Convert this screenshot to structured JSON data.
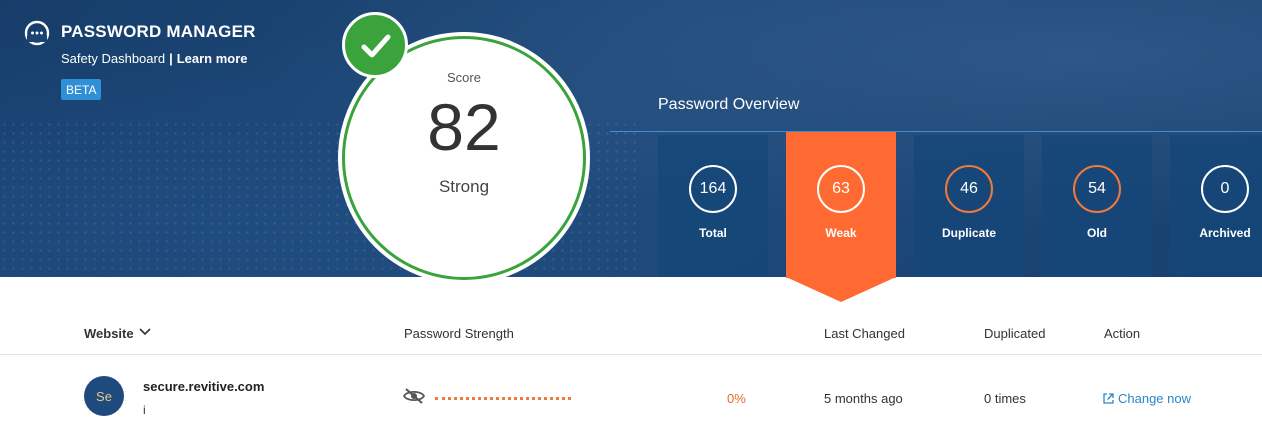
{
  "header": {
    "title": "PASSWORD MANAGER",
    "subtitle": "Safety Dashboard",
    "separator": "|",
    "learn_more": "Learn more",
    "badge": "BETA"
  },
  "score": {
    "label": "Score",
    "value": "82",
    "status": "Strong",
    "color": "#3aa33b"
  },
  "overview": {
    "title": "Password Overview",
    "tiles": [
      {
        "value": "164",
        "label": "Total"
      },
      {
        "value": "63",
        "label": "Weak",
        "active": true
      },
      {
        "value": "46",
        "label": "Duplicate"
      },
      {
        "value": "54",
        "label": "Old"
      },
      {
        "value": "0",
        "label": "Archived"
      }
    ],
    "active_color": "#ff6a32"
  },
  "table": {
    "columns": {
      "website": "Website",
      "strength": "Password Strength",
      "last_changed": "Last Changed",
      "duplicated": "Duplicated",
      "action": "Action"
    },
    "rows": [
      {
        "avatar": "Se",
        "site": "secure.revitive.com",
        "sub": "i",
        "strength_pct": "0%",
        "last_changed": "5 months ago",
        "duplicated": "0 times",
        "action": "Change now"
      }
    ]
  }
}
